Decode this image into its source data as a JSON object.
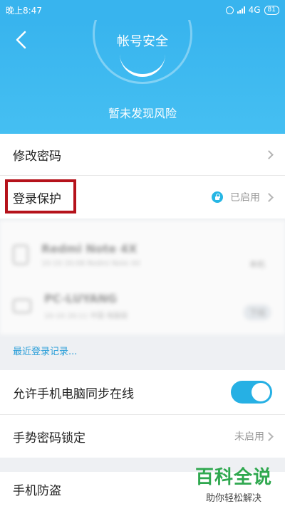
{
  "status_bar": {
    "time": "晚上8:47",
    "network": "4G",
    "battery": "81"
  },
  "header": {
    "title": "帐号安全",
    "status_text": "暂未发现风险"
  },
  "menu": {
    "change_password": "修改密码",
    "login_protection": "登录保护",
    "login_protection_status": "已启用",
    "allow_sync": "允许手机电脑同步在线",
    "gesture_lock": "手势密码锁定",
    "gesture_lock_status": "未启用",
    "anti_theft": "手机防盗"
  },
  "devices": [
    {
      "name": "Redmi Note 4X",
      "detail": "10-10 20:08 Redmi Note 4X",
      "tag": "本机"
    },
    {
      "name": "PC-LUYANG",
      "detail": "10-10 20:11 中国 电脑版",
      "tag": "下线"
    }
  ],
  "recent_login_link": "最近登录记录...",
  "watermark": {
    "title": "百科全说",
    "subtitle": "助你轻松解决"
  },
  "colors": {
    "header": "#38b4ee",
    "accent": "#26b0e4",
    "highlight": "#b5121b"
  }
}
